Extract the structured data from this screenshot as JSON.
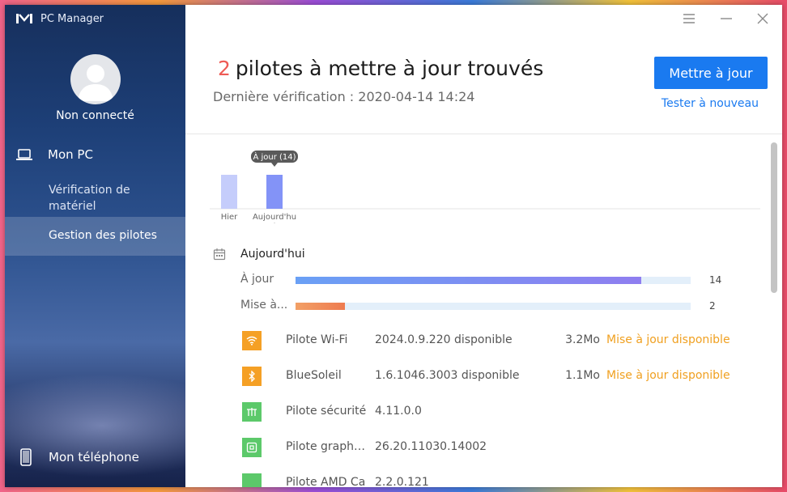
{
  "app": {
    "title": "PC Manager"
  },
  "sidebar": {
    "login_status": "Non connecté",
    "nav_pc": "Mon PC",
    "nav_hardware": "Vérification de matériel",
    "nav_drivers": "Gestion des pilotes",
    "nav_phone": "Mon téléphone"
  },
  "header": {
    "count": "2",
    "title": "pilotes à mettre à jour trouvés",
    "last_check": "Dernière vérification : 2020-04-14 14:24",
    "update_button": "Mettre à jour",
    "retest_link": "Tester à nouveau"
  },
  "chart_data": {
    "type": "bar",
    "categories": [
      "Hier",
      "Aujourd'hui"
    ],
    "values": [
      14,
      14
    ],
    "tooltip": "À jour (14)",
    "colors": [
      "#c5cdfb",
      "#8393f7"
    ]
  },
  "summary": {
    "date_label": "Aujourd'hui",
    "uptodate_label": "À jour",
    "uptodate_count": "14",
    "uptodate_fraction": 0.875,
    "pending_label": "Mise à...",
    "pending_count": "2",
    "pending_fraction": 0.125
  },
  "drivers": [
    {
      "name": "Pilote Wi-Fi",
      "version": "2024.0.9.220 disponible",
      "size": "3.2Mo",
      "status": "Mise à jour disponible",
      "icon": "wifi-icon",
      "color": "#f5a025"
    },
    {
      "name": "BlueSoleil",
      "version": "1.6.1046.3003 disponible",
      "size": "1.1Mo",
      "status": "Mise à jour disponible",
      "icon": "bluetooth-icon",
      "color": "#f5a025"
    },
    {
      "name": "Pilote sécurité",
      "version": "4.11.0.0",
      "size": "",
      "status": "",
      "icon": "security-chip-icon",
      "color": "#5cc96a"
    },
    {
      "name": "Pilote graphique",
      "version": "26.20.11030.14002",
      "size": "",
      "status": "",
      "icon": "graphics-icon",
      "color": "#5cc96a"
    },
    {
      "name": "Pilote AMD Ca",
      "version": "2.2.0.121",
      "size": "",
      "status": "",
      "icon": "driver-icon",
      "color": "#5cc96a"
    }
  ]
}
